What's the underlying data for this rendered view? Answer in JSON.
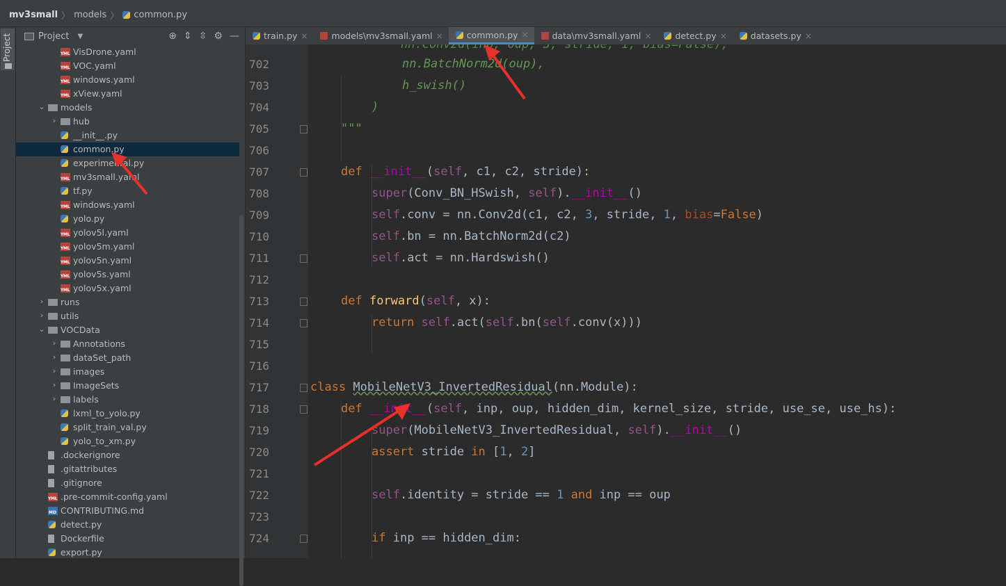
{
  "breadcrumb": {
    "root": "mv3small",
    "folder": "models",
    "file": "common.py"
  },
  "left_strip": {
    "tab_label": "Project"
  },
  "project_panel": {
    "title": "Project",
    "tree": [
      {
        "label": "VisDrone.yaml",
        "type": "yaml",
        "depth": 3
      },
      {
        "label": "VOC.yaml",
        "type": "yaml",
        "depth": 3
      },
      {
        "label": "windows.yaml",
        "type": "yaml",
        "depth": 3
      },
      {
        "label": "xView.yaml",
        "type": "yaml",
        "depth": 3
      },
      {
        "label": "models",
        "type": "folder",
        "depth": 2,
        "expanded": true
      },
      {
        "label": "hub",
        "type": "folder",
        "depth": 3,
        "expanded": false
      },
      {
        "label": "__init__.py",
        "type": "py",
        "depth": 3
      },
      {
        "label": "common.py",
        "type": "py",
        "depth": 3,
        "selected": true
      },
      {
        "label": "experimental.py",
        "type": "py",
        "depth": 3
      },
      {
        "label": "mv3small.yaml",
        "type": "yaml",
        "depth": 3
      },
      {
        "label": "tf.py",
        "type": "py",
        "depth": 3
      },
      {
        "label": "windows.yaml",
        "type": "yaml",
        "depth": 3
      },
      {
        "label": "yolo.py",
        "type": "py",
        "depth": 3
      },
      {
        "label": "yolov5l.yaml",
        "type": "yaml",
        "depth": 3
      },
      {
        "label": "yolov5m.yaml",
        "type": "yaml",
        "depth": 3
      },
      {
        "label": "yolov5n.yaml",
        "type": "yaml",
        "depth": 3
      },
      {
        "label": "yolov5s.yaml",
        "type": "yaml",
        "depth": 3
      },
      {
        "label": "yolov5x.yaml",
        "type": "yaml",
        "depth": 3
      },
      {
        "label": "runs",
        "type": "folder",
        "depth": 2,
        "expanded": false
      },
      {
        "label": "utils",
        "type": "folder",
        "depth": 2,
        "expanded": false
      },
      {
        "label": "VOCData",
        "type": "folder",
        "depth": 2,
        "expanded": true
      },
      {
        "label": "Annotations",
        "type": "folder",
        "depth": 3,
        "expanded": false
      },
      {
        "label": "dataSet_path",
        "type": "folder",
        "depth": 3,
        "expanded": false
      },
      {
        "label": "images",
        "type": "folder",
        "depth": 3,
        "expanded": false
      },
      {
        "label": "ImageSets",
        "type": "folder",
        "depth": 3,
        "expanded": false
      },
      {
        "label": "labels",
        "type": "folder",
        "depth": 3,
        "expanded": false
      },
      {
        "label": "lxml_to_yolo.py",
        "type": "py",
        "depth": 3
      },
      {
        "label": "split_train_val.py",
        "type": "py",
        "depth": 3
      },
      {
        "label": "yolo_to_xm.py",
        "type": "py",
        "depth": 3
      },
      {
        "label": ".dockerignore",
        "type": "file",
        "depth": 2
      },
      {
        "label": ".gitattributes",
        "type": "file",
        "depth": 2
      },
      {
        "label": ".gitignore",
        "type": "ignore",
        "depth": 2
      },
      {
        "label": ".pre-commit-config.yaml",
        "type": "yaml",
        "depth": 2
      },
      {
        "label": "CONTRIBUTING.md",
        "type": "md",
        "depth": 2
      },
      {
        "label": "detect.py",
        "type": "py",
        "depth": 2
      },
      {
        "label": "Dockerfile",
        "type": "file",
        "depth": 2
      },
      {
        "label": "export.py",
        "type": "py",
        "depth": 2
      }
    ]
  },
  "tabs": [
    {
      "label": "train.py",
      "type": "py",
      "active": false
    },
    {
      "label": "models\\mv3small.yaml",
      "type": "yaml",
      "active": false
    },
    {
      "label": "common.py",
      "type": "py",
      "active": true
    },
    {
      "label": "data\\mv3small.yaml",
      "type": "yaml",
      "active": false
    },
    {
      "label": "detect.py",
      "type": "py",
      "active": false
    },
    {
      "label": "datasets.py",
      "type": "py",
      "active": false
    }
  ],
  "editor": {
    "lines": [
      {
        "n": "702",
        "indent": 3,
        "tokens": [
          {
            "c": "str",
            "t": "nn.BatchNorm2d(oup),"
          }
        ]
      },
      {
        "n": "703",
        "indent": 3,
        "tokens": [
          {
            "c": "str",
            "t": "h_swish()"
          }
        ]
      },
      {
        "n": "704",
        "indent": 2,
        "tokens": [
          {
            "c": "str",
            "t": ")"
          }
        ]
      },
      {
        "n": "705",
        "indent": 1,
        "fold": true,
        "tokens": [
          {
            "c": "str",
            "t": "\"\"\""
          }
        ]
      },
      {
        "n": "706",
        "indent": 0,
        "tokens": []
      },
      {
        "n": "707",
        "indent": 1,
        "fold": true,
        "tokens": [
          {
            "c": "k",
            "t": "def "
          },
          {
            "c": "mg",
            "t": "__init__"
          },
          {
            "c": "p",
            "t": "("
          },
          {
            "c": "s",
            "t": "self"
          },
          {
            "c": "p",
            "t": ", c1, c2, stride):"
          }
        ]
      },
      {
        "n": "708",
        "indent": 2,
        "tokens": [
          {
            "c": "s",
            "t": "super"
          },
          {
            "c": "p",
            "t": "(Conv_BN_HSwish, "
          },
          {
            "c": "s",
            "t": "self"
          },
          {
            "c": "p",
            "t": ")."
          },
          {
            "c": "mg",
            "t": "__init__"
          },
          {
            "c": "p",
            "t": "()"
          }
        ]
      },
      {
        "n": "709",
        "indent": 2,
        "tokens": [
          {
            "c": "s",
            "t": "self"
          },
          {
            "c": "p",
            "t": ".conv = nn.Conv2d(c1, c2, "
          },
          {
            "c": "num",
            "t": "3"
          },
          {
            "c": "p",
            "t": ", stride, "
          },
          {
            "c": "num",
            "t": "1"
          },
          {
            "c": "p",
            "t": ", "
          },
          {
            "c": "kw",
            "t": "bias"
          },
          {
            "c": "p",
            "t": "="
          },
          {
            "c": "k",
            "t": "False"
          },
          {
            "c": "p",
            "t": ")"
          }
        ]
      },
      {
        "n": "710",
        "indent": 2,
        "tokens": [
          {
            "c": "s",
            "t": "self"
          },
          {
            "c": "p",
            "t": ".bn = nn.BatchNorm2d(c2)"
          }
        ]
      },
      {
        "n": "711",
        "indent": 2,
        "fold": true,
        "tokens": [
          {
            "c": "s",
            "t": "self"
          },
          {
            "c": "p",
            "t": ".act = nn.Hardswish()"
          }
        ]
      },
      {
        "n": "712",
        "indent": 0,
        "tokens": []
      },
      {
        "n": "713",
        "indent": 1,
        "fold": true,
        "tokens": [
          {
            "c": "k",
            "t": "def "
          },
          {
            "c": "fn",
            "t": "forward"
          },
          {
            "c": "p",
            "t": "("
          },
          {
            "c": "s",
            "t": "self"
          },
          {
            "c": "p",
            "t": ", x):"
          }
        ]
      },
      {
        "n": "714",
        "indent": 2,
        "fold": true,
        "tokens": [
          {
            "c": "k",
            "t": "return "
          },
          {
            "c": "s",
            "t": "self"
          },
          {
            "c": "p",
            "t": ".act("
          },
          {
            "c": "s",
            "t": "self"
          },
          {
            "c": "p",
            "t": ".bn("
          },
          {
            "c": "s",
            "t": "self"
          },
          {
            "c": "p",
            "t": ".conv(x)))"
          }
        ]
      },
      {
        "n": "715",
        "indent": 0,
        "tokens": []
      },
      {
        "n": "716",
        "indent": 0,
        "tokens": []
      },
      {
        "n": "717",
        "indent": 0,
        "fold": true,
        "tokens": [
          {
            "c": "k",
            "t": "class "
          },
          {
            "c": "p u",
            "t": "MobileNetV3_InvertedResidual"
          },
          {
            "c": "p",
            "t": "(nn.Module):"
          }
        ]
      },
      {
        "n": "718",
        "indent": 1,
        "fold": true,
        "tokens": [
          {
            "c": "k",
            "t": "def "
          },
          {
            "c": "mg",
            "t": "__init__"
          },
          {
            "c": "p",
            "t": "("
          },
          {
            "c": "s",
            "t": "self"
          },
          {
            "c": "p",
            "t": ", inp, oup, hidden_dim, kernel_size, stride, use_se, use_hs):"
          }
        ]
      },
      {
        "n": "719",
        "indent": 2,
        "tokens": [
          {
            "c": "s",
            "t": "super"
          },
          {
            "c": "p",
            "t": "(MobileNetV3_InvertedResidual, "
          },
          {
            "c": "s",
            "t": "self"
          },
          {
            "c": "p",
            "t": ")."
          },
          {
            "c": "mg",
            "t": "__init__"
          },
          {
            "c": "p",
            "t": "()"
          }
        ]
      },
      {
        "n": "720",
        "indent": 2,
        "tokens": [
          {
            "c": "k",
            "t": "assert "
          },
          {
            "c": "p",
            "t": "stride "
          },
          {
            "c": "k",
            "t": "in "
          },
          {
            "c": "p",
            "t": "["
          },
          {
            "c": "num",
            "t": "1"
          },
          {
            "c": "p",
            "t": ", "
          },
          {
            "c": "num",
            "t": "2"
          },
          {
            "c": "p",
            "t": "]"
          }
        ]
      },
      {
        "n": "721",
        "indent": 0,
        "tokens": []
      },
      {
        "n": "722",
        "indent": 2,
        "tokens": [
          {
            "c": "s",
            "t": "self"
          },
          {
            "c": "p",
            "t": ".identity = stride == "
          },
          {
            "c": "num",
            "t": "1 "
          },
          {
            "c": "k",
            "t": "and "
          },
          {
            "c": "p",
            "t": "inp == oup"
          }
        ]
      },
      {
        "n": "723",
        "indent": 0,
        "tokens": []
      },
      {
        "n": "724",
        "indent": 2,
        "fold": true,
        "tokens": [
          {
            "c": "k",
            "t": "if "
          },
          {
            "c": "p",
            "t": "inp == hidden_dim:"
          }
        ]
      }
    ]
  },
  "colors": {
    "accent": "#4a88c7",
    "annotation_arrow": "#e8312a"
  }
}
